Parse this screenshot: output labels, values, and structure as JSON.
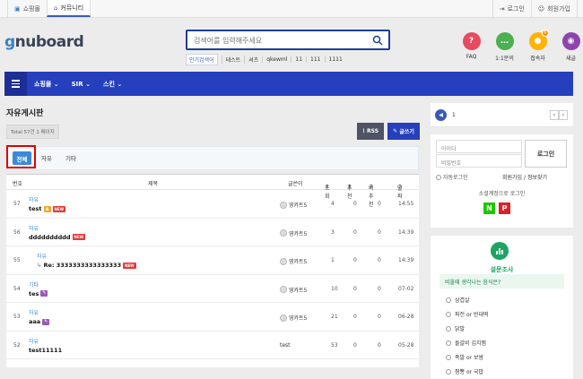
{
  "topbar": {
    "tabs": [
      {
        "label": "쇼핑몰"
      },
      {
        "label": "커뮤니티"
      }
    ],
    "right": [
      {
        "label": "로그인"
      },
      {
        "label": "회원가입"
      }
    ]
  },
  "header": {
    "logo": {
      "a": "g",
      "b": "nuboard"
    },
    "search_placeholder": "검색어를 입력해주세요",
    "popular_label": "인기검색어",
    "popular": [
      "테스트",
      "셔츠",
      "qkewml",
      "11",
      "111",
      "1111"
    ],
    "quick": [
      {
        "label": "FAQ",
        "glyph": "?",
        "color": "#e84a5f"
      },
      {
        "label": "1:1문의",
        "glyph": "…",
        "color": "#4caf50"
      },
      {
        "label": "접속자",
        "glyph": "●",
        "color": "#ffb300",
        "count": "6"
      },
      {
        "label": "새글",
        "glyph": "◉",
        "color": "#8e44ad"
      }
    ]
  },
  "nav": {
    "items": [
      "쇼핑몰",
      "SIR",
      "스킨"
    ]
  },
  "board": {
    "title": "자유게시판",
    "total": "Total 57건 1 페이지",
    "rss": "RSS",
    "write": "글쓰기",
    "categories": [
      "전체",
      "자유",
      "기타"
    ],
    "columns": {
      "num": "번호",
      "subject": "제목",
      "author": "글쓴이",
      "hit": "조회",
      "good": "추천",
      "bad": "비추천",
      "date": "날짜"
    },
    "rows": [
      {
        "num": "57",
        "cat": "자유",
        "subject": "test",
        "author": "영카트5",
        "hit": "4",
        "good": "0",
        "bad": "0",
        "date": "14:55"
      },
      {
        "num": "56",
        "cat": "자유",
        "subject": "dddddddddd",
        "author": "영카트5",
        "hit": "3",
        "good": "0",
        "bad": "0",
        "date": "14:39"
      },
      {
        "num": "55",
        "cat": "자유",
        "subject": "Re: 3333333333333333",
        "author": "영카트5",
        "hit": "1",
        "good": "0",
        "bad": "0",
        "date": "14:39"
      },
      {
        "num": "54",
        "cat": "기타",
        "subject": "tes",
        "author": "영카트5",
        "hit": "10",
        "good": "0",
        "bad": "0",
        "date": "07-02"
      },
      {
        "num": "53",
        "cat": "자유",
        "subject": "aaa",
        "author": "영카트5",
        "hit": "21",
        "good": "0",
        "bad": "0",
        "date": "06-28"
      },
      {
        "num": "52",
        "cat": "자유",
        "subject": "test11111",
        "author": "test",
        "hit": "53",
        "good": "0",
        "bad": "0",
        "date": "05-28"
      }
    ]
  },
  "side": {
    "notice_count": "1",
    "id_placeholder": "아이디",
    "pw_placeholder": "비밀번호",
    "login_btn": "로그인",
    "auto_login": "자동로그인",
    "join": "회원가입",
    "find": "정보찾기",
    "social_label": "소셜계정으로 로그인",
    "social": [
      {
        "label": "N",
        "color": "#1ec800"
      },
      {
        "label": "P",
        "color": "#e02020"
      }
    ],
    "poll_title": "설문조사",
    "poll_question": "비올때 생각나는 음식은?",
    "poll_options": [
      "삼겹살",
      "파전 or 빈대떡",
      "닭발",
      "돌갈비 김치찜",
      "족발 or 보쌈",
      "짬뽕 or 국밥"
    ]
  }
}
